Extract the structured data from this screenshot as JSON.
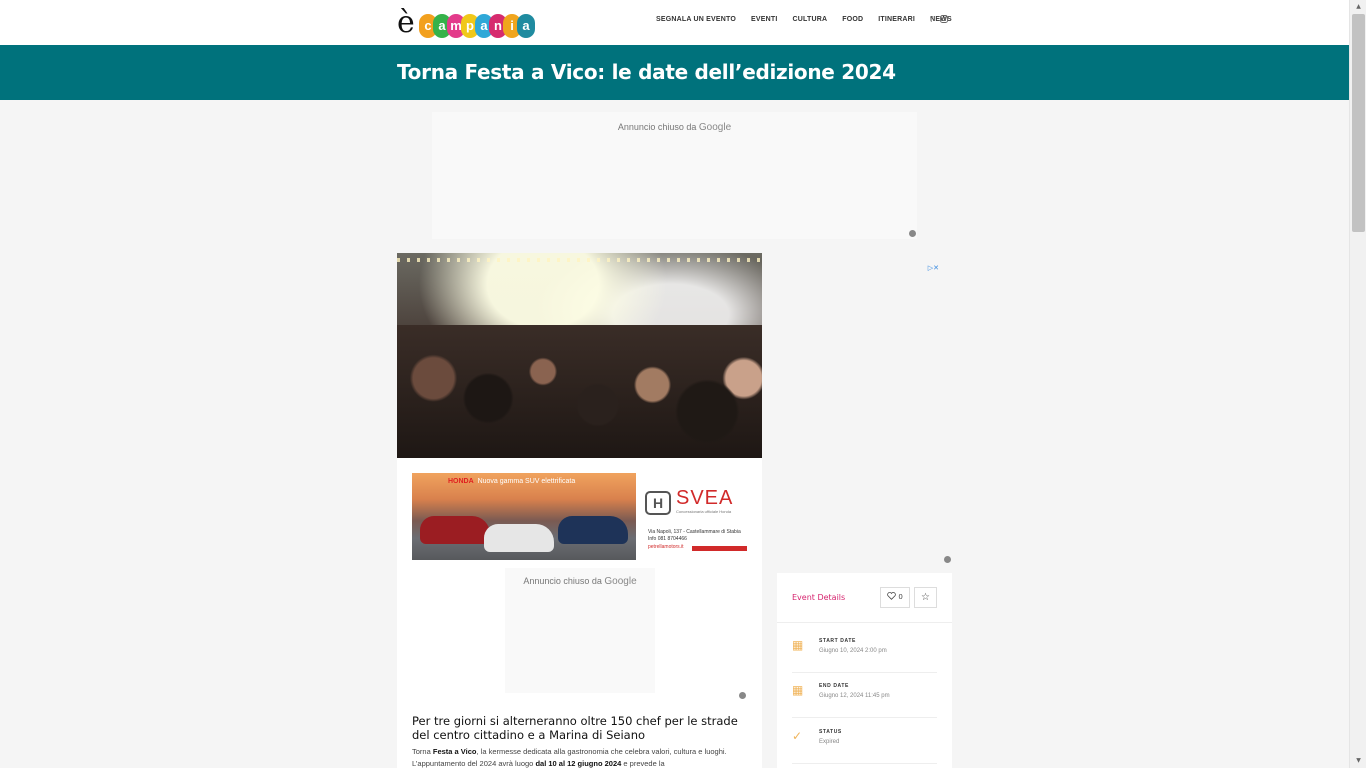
{
  "header": {
    "logo_letter": "è",
    "logo_word": [
      "c",
      "a",
      "m",
      "p",
      "a",
      "n",
      "i",
      "a"
    ],
    "logo_colors": [
      "#f2a01e",
      "#35b24a",
      "#e33b8b",
      "#f0c81a",
      "#2fa8d8",
      "#d62b6e",
      "#f0a51e",
      "#1f8ba0"
    ],
    "nav": [
      {
        "label": "SEGNALA UN EVENTO"
      },
      {
        "label": "EVENTI"
      },
      {
        "label": "CULTURA"
      },
      {
        "label": "FOOD"
      },
      {
        "label": "ITINERARI"
      },
      {
        "label": "NEWS"
      }
    ],
    "social": [
      "facebook-icon",
      "instagram-icon"
    ]
  },
  "page": {
    "title": "Torna Festa a Vico: le date dell’edizione 2024"
  },
  "ads": {
    "closed_prefix": "Annuncio chiuso da",
    "closed_brand": "Google",
    "adchoices": "▷✕"
  },
  "banner": {
    "honda": "HONDA",
    "honda_tagline": "Nuova gamma SUV elettrificata",
    "svea": "SVEA",
    "svea_sub": "Concessionaria ufficiale Honda",
    "address_1": "Via Napoli, 137 - Castellammare di Stabia",
    "address_2": "Info 081 8704466",
    "url": "petrellamotors.it"
  },
  "article": {
    "subtitle": "Per tre giorni si alterneranno oltre 150 chef per le strade del centro cittadino e a Marina di Seiano",
    "body_1": "Torna ",
    "body_bold_1": "Festa a Vico",
    "body_2": ", la kermesse dedicata alla gastronomia che celebra valori, cultura e luoghi. L’appuntamento del 2024 avrà luogo ",
    "body_bold_2": "dal 10 al 12 giugno 2024",
    "body_3": " e prevede la"
  },
  "event_details": {
    "label": "Event Details",
    "likes": "0",
    "rows": [
      {
        "key": "START DATE",
        "value": "Giugno 10, 2024 2:00 pm",
        "icon": "calendar-icon"
      },
      {
        "key": "END DATE",
        "value": "Giugno 12, 2024 11:45 pm",
        "icon": "calendar-icon"
      },
      {
        "key": "STATUS",
        "value": "Expired",
        "icon": "check-circle-icon"
      }
    ]
  }
}
